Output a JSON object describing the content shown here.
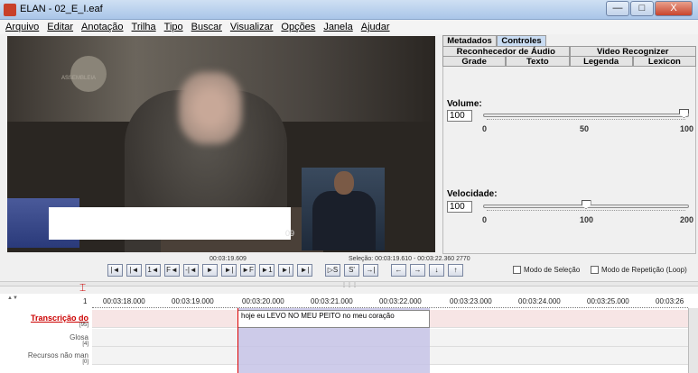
{
  "window": {
    "title": "ELAN - 02_E_I.eaf",
    "controls": [
      "—",
      "□",
      "X"
    ]
  },
  "menu": [
    "Arquivo",
    "Editar",
    "Anotação",
    "Trilha",
    "Tipo",
    "Buscar",
    "Visualizar",
    "Opções",
    "Janela",
    "Ajudar"
  ],
  "video": {
    "logo_text": "ASSEMBLEIA",
    "corner_text": "09"
  },
  "panel": {
    "tabs_row1": [
      "Metadados",
      "Controles"
    ],
    "tabs_row2": [
      "Reconhecedor de Áudio",
      "Video Recognizer"
    ],
    "tabs_row3": [
      "Grade",
      "Texto",
      "Legenda",
      "Lexicon"
    ],
    "volume": {
      "label": "Volume:",
      "value": "100",
      "ticks": [
        "0",
        "50",
        "100"
      ],
      "level": 1.0
    },
    "speed": {
      "label": "Velocidade:",
      "value": "100",
      "ticks": [
        "0",
        "100",
        "200"
      ],
      "level": 0.5
    }
  },
  "transport": {
    "current_time": "00:03:19.609",
    "selection": "Seleção: 00:03:19.610 - 00:03:22.360  2770",
    "buttons": [
      "|◄",
      "|◄",
      "1◄",
      "F◄",
      "-|◄",
      "►",
      "►|",
      "►F",
      "►1",
      "►|",
      "►|"
    ],
    "sel_buttons": [
      "▷S",
      "S'",
      "→|"
    ],
    "arrows": [
      "←",
      "→",
      "↓",
      "↑"
    ],
    "mode_selection": "Modo de Seleção",
    "mode_loop": "Modo de Repetição (Loop)"
  },
  "timeline": {
    "ruler": [
      "00:03:18.000",
      "00:03:19.000",
      "00:03:20.000",
      "00:03:21.000",
      "00:03:22.000",
      "00:03:23.000",
      "00:03:24.000",
      "00:03:25.000",
      "00:03:26"
    ],
    "ruler_first": "1",
    "tiers": [
      {
        "name": "Transcrição do",
        "count": "[95]"
      },
      {
        "name": "Glosa",
        "count": "[4]"
      },
      {
        "name": "Recursos não man",
        "count": "[0]"
      }
    ],
    "annotation": "hoje eu LEVO NO MEU PEITO no meu coração"
  }
}
